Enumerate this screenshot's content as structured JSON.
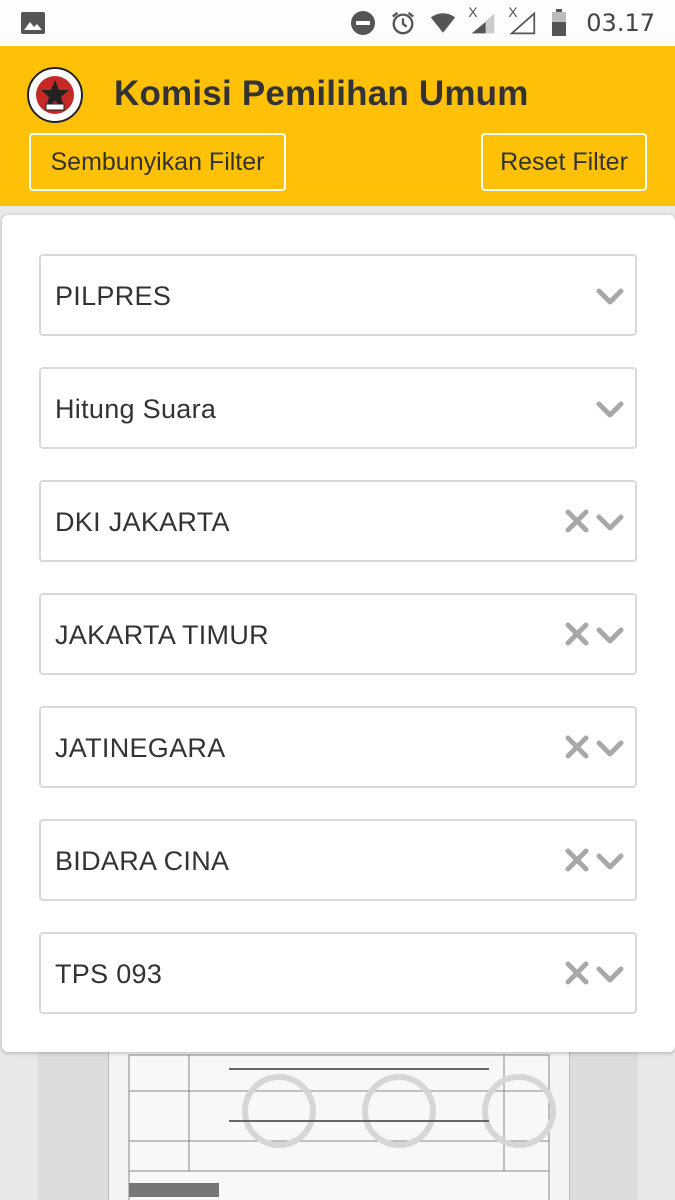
{
  "status_bar": {
    "time": "03.17",
    "signal_label_1": "X",
    "signal_label_2": "X"
  },
  "header": {
    "title": "Komisi Pemilihan Umum",
    "logo_text": "KOMISI PEMILIHAN UMUM",
    "hide_filter_label": "Sembunyikan Filter",
    "reset_filter_label": "Reset Filter"
  },
  "filters": [
    {
      "value": "PILPRES",
      "clearable": false
    },
    {
      "value": "Hitung Suara",
      "clearable": false
    },
    {
      "value": "DKI JAKARTA",
      "clearable": true
    },
    {
      "value": "JAKARTA TIMUR",
      "clearable": true
    },
    {
      "value": "JATINEGARA",
      "clearable": true
    },
    {
      "value": "BIDARA CINA",
      "clearable": true
    },
    {
      "value": "TPS 093",
      "clearable": true
    }
  ],
  "colors": {
    "header_bg": "#ffc107",
    "text": "#333333",
    "border": "#d9d9d9",
    "icon": "#a8a8a8"
  }
}
